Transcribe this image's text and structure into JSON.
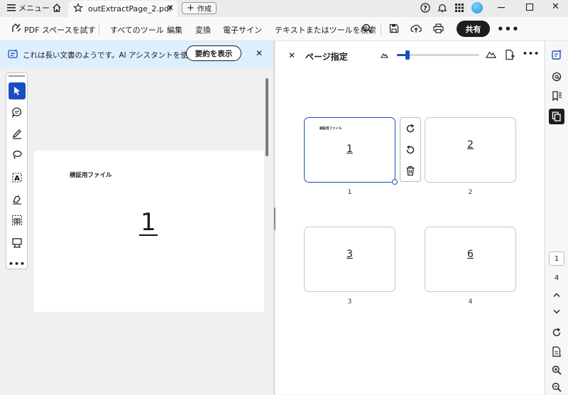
{
  "titlebar": {
    "menu_label": "メニュー",
    "tab_title": "outExtractPage_2.pdf",
    "new_tab_label": "作成"
  },
  "toolbar": {
    "try_pdf_spaces": "PDF スペースを試す",
    "all_tools": "すべてのツール",
    "edit": "編集",
    "convert": "変換",
    "e_sign": "電子サイン",
    "search_placeholder": "テキストまたはツールを検索",
    "share": "共有"
  },
  "banner": {
    "message": "これは長い文書のようです。AI アシスタントを使...",
    "summary_button": "要約を表示"
  },
  "document": {
    "page_heading": "検証用ファイル",
    "page_number_text": "1"
  },
  "panel": {
    "title": "ページ指定",
    "zoom_level": 0.13,
    "thumbnails": [
      {
        "content": "1",
        "label": "1",
        "selected": true,
        "mini_heading": "検証用ファイル"
      },
      {
        "content": "2",
        "label": "2",
        "selected": false
      },
      {
        "content": "3",
        "label": "3",
        "selected": false
      },
      {
        "content": "6",
        "label": "4",
        "selected": false
      }
    ]
  },
  "rightrail": {
    "current_page": "1",
    "total_pages": "4"
  },
  "colors": {
    "accent": "#1a4fc4",
    "banner_bg": "#ddeefd",
    "share_bg": "#1d1d1d"
  }
}
